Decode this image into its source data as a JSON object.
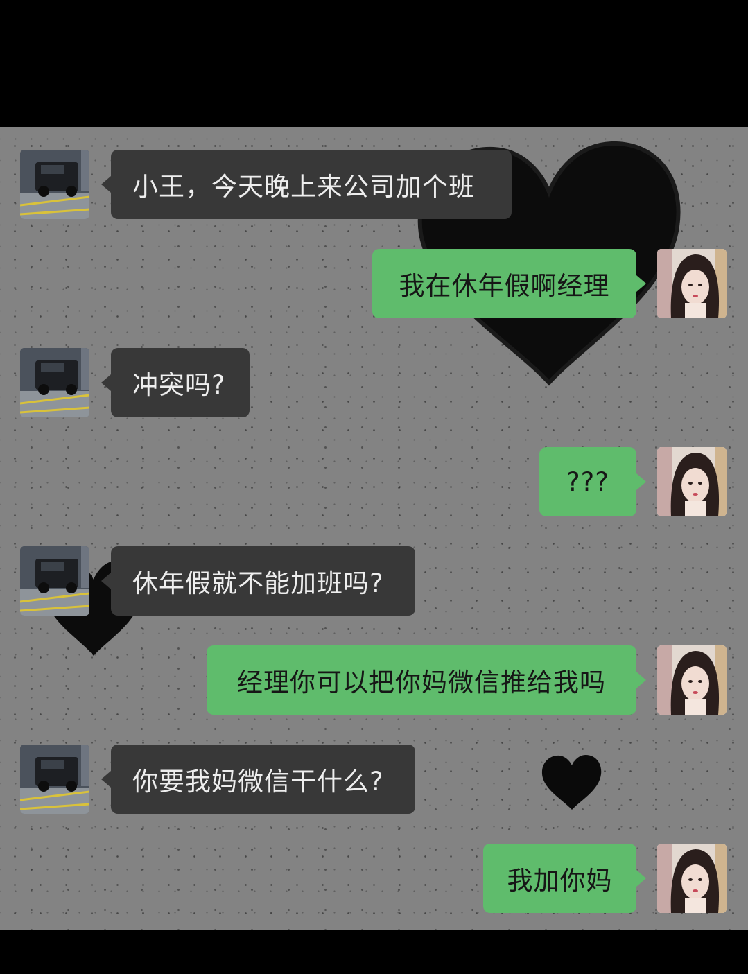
{
  "chat": {
    "messages": [
      {
        "sender": "manager",
        "side": "left",
        "text": "小王，今天晚上来公司加个班"
      },
      {
        "sender": "me",
        "side": "right",
        "text": "我在休年假啊经理"
      },
      {
        "sender": "manager",
        "side": "left",
        "text": "冲突吗?"
      },
      {
        "sender": "me",
        "side": "right",
        "text": "???"
      },
      {
        "sender": "manager",
        "side": "left",
        "text": "休年假就不能加班吗?"
      },
      {
        "sender": "me",
        "side": "right",
        "text": "经理你可以把你妈微信推给我吗"
      },
      {
        "sender": "manager",
        "side": "left",
        "text": "你要我妈微信干什么?"
      },
      {
        "sender": "me",
        "side": "right",
        "text": "我加你妈"
      }
    ],
    "avatars": {
      "manager": "car-photo-avatar",
      "me": "girl-photo-avatar"
    }
  },
  "colors": {
    "background": "#838383",
    "incoming_bubble": "#383838",
    "outgoing_bubble": "#5fbc6c",
    "incoming_text": "#eeeeee",
    "outgoing_text": "#161616",
    "frame": "#000000"
  }
}
